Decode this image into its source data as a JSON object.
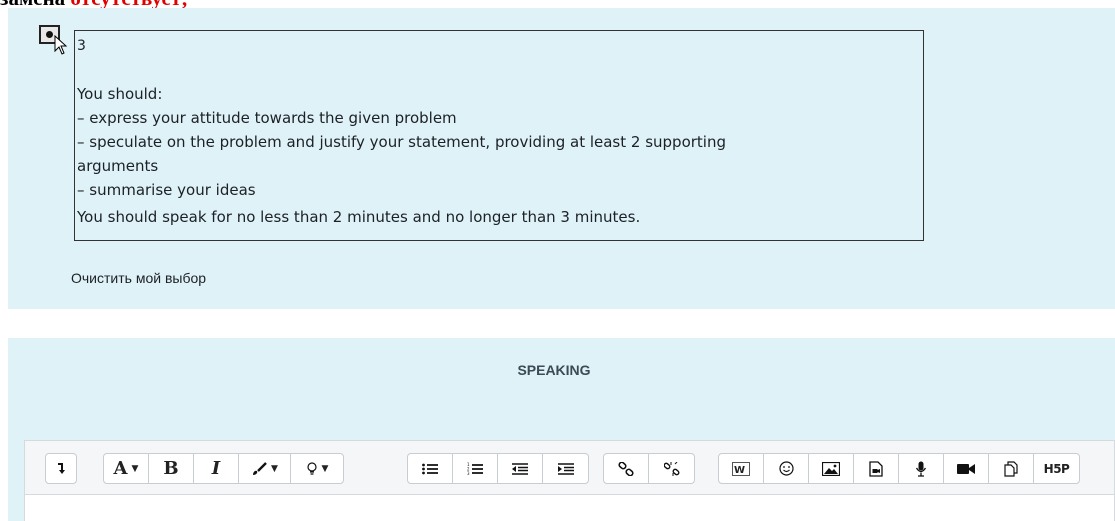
{
  "top_heading": {
    "black_text": "замена ",
    "red_text": "отсутствует;"
  },
  "question": {
    "answer_number": "3",
    "intro": "You should:",
    "points": [
      "– express your attitude towards the given problem",
      "– speculate on the problem and justify your statement, providing at least 2 supporting",
      "arguments",
      "– summarise your ideas"
    ],
    "time_note": "You should speak for no less than 2 minutes and no longer than 3 minutes.",
    "clear_choice_label": "Очистить мой выбор"
  },
  "speaking": {
    "title": "SPEAKING",
    "toolbar": {
      "groups": [
        [
          "collapse-icon"
        ],
        [
          "font-color-icon",
          "bold-icon",
          "italic-icon",
          "brush-icon",
          "lightbulb-icon"
        ],
        [
          "unordered-list-icon",
          "ordered-list-icon",
          "outdent-icon",
          "indent-icon"
        ],
        [
          "link-icon",
          "unlink-icon"
        ],
        [
          "word-import-icon",
          "emoji-icon",
          "image-icon",
          "media-icon",
          "microphone-icon",
          "video-icon",
          "manage-files-icon",
          "h5p-icon"
        ]
      ],
      "labels": {
        "font": "A",
        "bold": "B",
        "italic": "I",
        "h5p": "H5P"
      }
    }
  }
}
